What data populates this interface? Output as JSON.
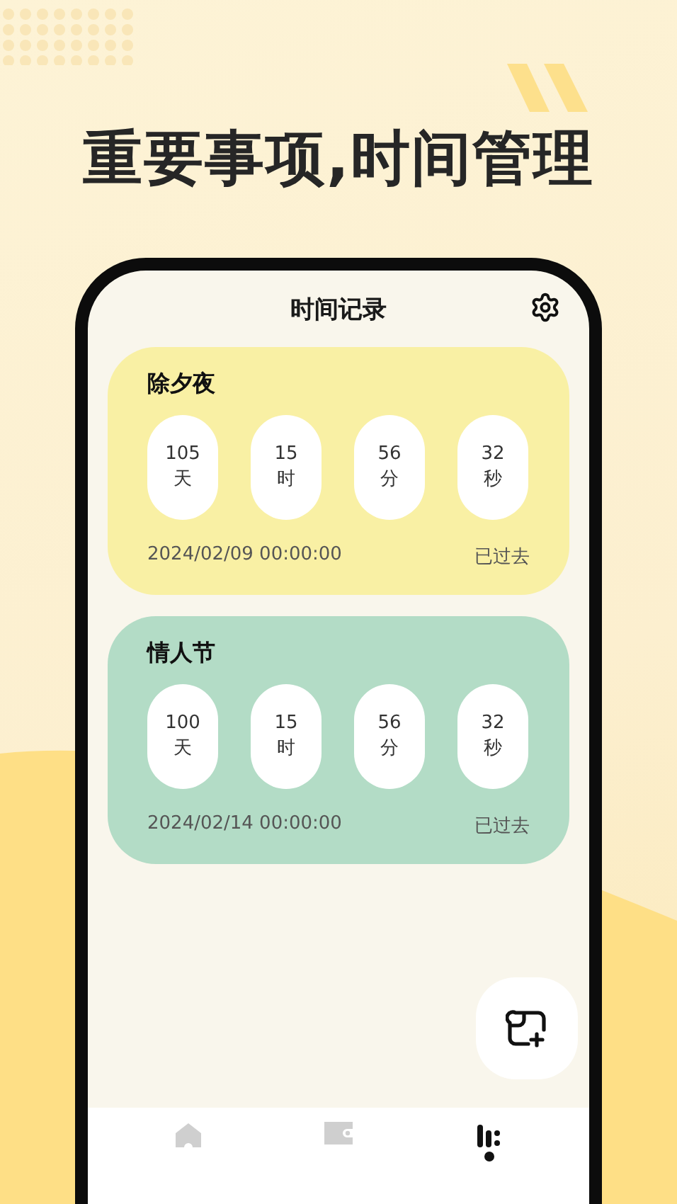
{
  "headline": "重要事项,时间管理",
  "screen": {
    "title": "时间记录"
  },
  "events": [
    {
      "name": "除夕夜",
      "color": "#f9f0a4",
      "units": [
        {
          "value": "105",
          "unit": "天"
        },
        {
          "value": "15",
          "unit": "时"
        },
        {
          "value": "56",
          "unit": "分"
        },
        {
          "value": "32",
          "unit": "秒"
        }
      ],
      "date": "2024/02/09 00:00:00",
      "status": "已过去"
    },
    {
      "name": "情人节",
      "color": "#b3dcc6",
      "units": [
        {
          "value": "100",
          "unit": "天"
        },
        {
          "value": "15",
          "unit": "时"
        },
        {
          "value": "56",
          "unit": "分"
        },
        {
          "value": "32",
          "unit": "秒"
        }
      ],
      "date": "2024/02/14 00:00:00",
      "status": "已过去"
    }
  ],
  "tabs": [
    {
      "kind": "home",
      "selected": false
    },
    {
      "kind": "wallet",
      "selected": false
    },
    {
      "kind": "stats",
      "selected": true
    }
  ]
}
